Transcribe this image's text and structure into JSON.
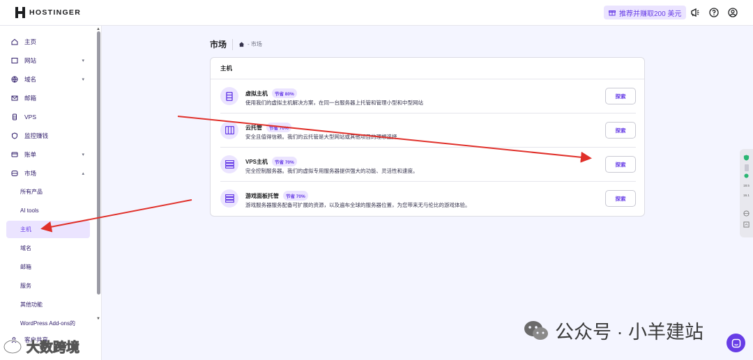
{
  "brand": {
    "name": "HOSTINGER"
  },
  "topbar": {
    "referral_label": "推荐并赚取200 美元"
  },
  "sidebar": {
    "items": [
      {
        "label": "主页",
        "icon": "home-icon",
        "chevron": ""
      },
      {
        "label": "网站",
        "icon": "website-icon",
        "chevron": "▾"
      },
      {
        "label": "域名",
        "icon": "globe-icon",
        "chevron": "▾"
      },
      {
        "label": "邮箱",
        "icon": "mail-icon",
        "chevron": ""
      },
      {
        "label": "VPS",
        "icon": "server-icon",
        "chevron": ""
      },
      {
        "label": "监控赚钱",
        "icon": "shield-icon",
        "chevron": ""
      },
      {
        "label": "账单",
        "icon": "billing-icon",
        "chevron": "▾"
      },
      {
        "label": "市场",
        "icon": "market-icon",
        "chevron": "▴"
      }
    ],
    "sub_items": [
      "所有产品",
      "AI tools",
      "主机",
      "域名",
      "邮箱",
      "服务",
      "其他功能",
      "WordPress Add-ons的"
    ],
    "active_sub": "主机",
    "footer_item": "客户共享"
  },
  "page": {
    "title": "市场",
    "breadcrumb": "- 市场"
  },
  "card": {
    "title": "主机",
    "rows": [
      {
        "title": "虚拟主机",
        "badge": "节省 80%",
        "desc": "使用我们的虚拟主机解决方案，在同一台服务器上托管和管理小型和中型网站",
        "button": "探索"
      },
      {
        "title": "云托管",
        "badge": "节省 70%",
        "desc": "安全且值得信赖。我们的云托管是大型网站或其他项目的理想选择",
        "button": "探索"
      },
      {
        "title": "VPS主机",
        "badge": "节省 70%",
        "desc": "完全控制服务器。我们的虚拟专用服务器提供强大的功能、灵活性和速度。",
        "button": "探索"
      },
      {
        "title": "游戏面板托管",
        "badge": "节省 70%",
        "desc": "游戏服务器服务配备可扩展的资源，以及遍布全球的服务器位置，为您带来无与伦比的游戏体验。",
        "button": "探索"
      }
    ]
  },
  "side_tools": {
    "values": [
      "18.5",
      "16.1"
    ]
  },
  "watermark": {
    "right_text": "公众号 · 小羊建站",
    "left_text": "大数跨境"
  },
  "colors": {
    "accent": "#673de6",
    "accent_light": "#ebe4ff",
    "annotation_arrow": "#e0302a"
  }
}
